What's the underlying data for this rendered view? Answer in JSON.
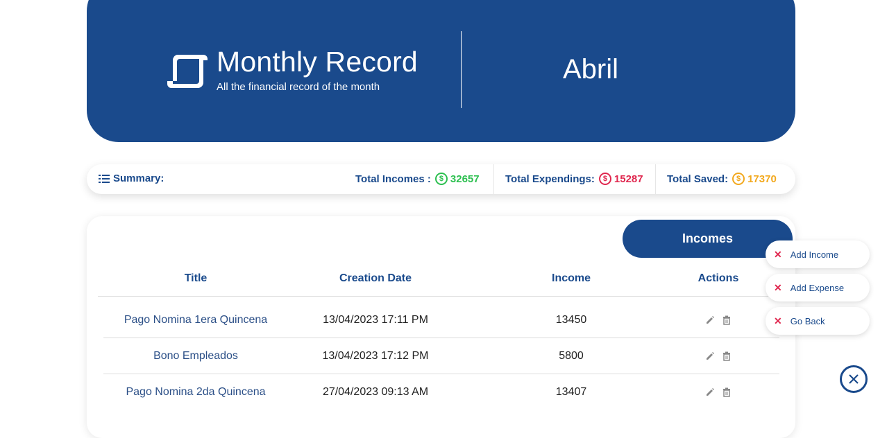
{
  "header": {
    "title": "Monthly Record",
    "subtitle": "All the financial record of the month",
    "month": "Abril",
    "logo_icon": "scroll-icon"
  },
  "summary": {
    "label": "Summary:",
    "incomes_label": "Total Incomes :",
    "incomes_value": "32657",
    "expendings_label": "Total Expendings:",
    "expendings_value": "15287",
    "saved_label": "Total Saved:",
    "saved_value": "17370",
    "colors": {
      "income": "#2cbf4f",
      "expense": "#e0284f",
      "saved": "#f2a81d"
    }
  },
  "table": {
    "tab_label": "Incomes",
    "columns": [
      "Title",
      "Creation Date",
      "Income",
      "Actions"
    ],
    "rows": [
      {
        "title": "Pago Nomina 1era Quincena",
        "date": "13/04/2023 17:11 PM",
        "income": "13450"
      },
      {
        "title": "Bono Empleados",
        "date": "13/04/2023 17:12 PM",
        "income": "5800"
      },
      {
        "title": "Pago Nomina 2da Quincena",
        "date": "27/04/2023 09:13 AM",
        "income": "13407"
      }
    ]
  },
  "fab_menu": {
    "items": [
      "Add Income",
      "Add Expense",
      "Go Back"
    ]
  },
  "colors": {
    "primary": "#1a4a8c",
    "danger": "#e0284f"
  }
}
